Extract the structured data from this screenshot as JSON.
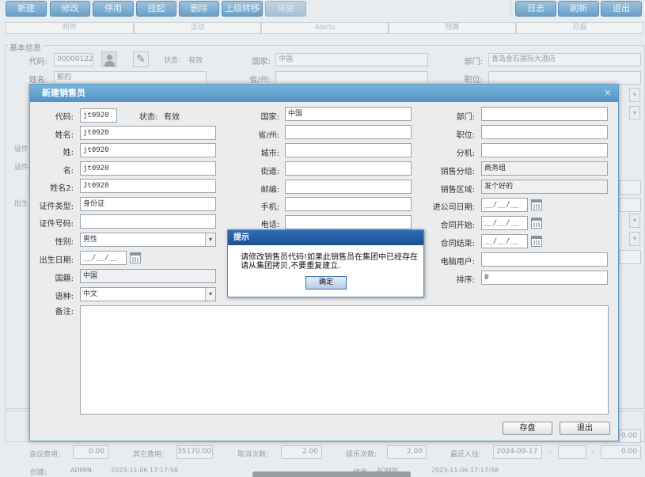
{
  "toolbar": {
    "new": "新建",
    "edit": "修改",
    "disable": "停用",
    "suspend": "挂起",
    "delete": "删除",
    "move_superior": "上级转移",
    "restore": "恢复",
    "log": "日志",
    "refresh": "刷新",
    "exit": "退出"
  },
  "panel_tabs": [
    "附件",
    "活动",
    "Alerts",
    "预算",
    "月报"
  ],
  "base_section": {
    "legend": "基本信息",
    "code_label": "代码:",
    "code_value": "00000122",
    "status_label": "状态:",
    "status_value": "有效",
    "country_label": "国家:",
    "country_value": "中国",
    "dept_label": "部门:",
    "dept_value": "青岛金石国际大酒店",
    "name_label": "姓名:",
    "name_value": "鄞的",
    "province_label": "省/州:",
    "position_label": "职位:",
    "side_labels": [
      "证件",
      "证件",
      "出生"
    ]
  },
  "bottom_bar": {
    "meeting_fee_label": "会议费用:",
    "meeting_fee": "0.00",
    "other_fee_label": "其它费用:",
    "other_fee": "35170.00",
    "cancel_count_label": "取消次数:",
    "cancel_count": "2.00",
    "ent_count_label": "娱乐次数:",
    "ent_count": "2.00",
    "recent_checkin_label": "最近入住:",
    "recent_checkin": "2024-09-17",
    "dash": "-",
    "right_value_1": "0.00",
    "right_value_2": "0.00",
    "created_label": "创建:",
    "created_user": "ADMIN",
    "created_time": "2023-11-06 17:17:58",
    "modified_label": "修改:",
    "modified_user": "ADMIN",
    "modified_time": "2023-11-06 17:17:58"
  },
  "dialog": {
    "title": "新建销售员",
    "close": "×",
    "code_label": "代码:",
    "code_value": "jt0920",
    "status_label": "状态:",
    "status_value": "有效",
    "name_label": "姓名:",
    "name_value": "jt0920",
    "surname_label": "姓:",
    "surname_value": "jt0920",
    "given_label": "名:",
    "given_value": "jt0920",
    "name2_label": "姓名2:",
    "name2_value": "Jt0920",
    "idtype_label": "证件类型:",
    "idtype_value": "身份证",
    "idno_label": "证件号码:",
    "gender_label": "性别:",
    "gender_value": "男性",
    "birth_label": "出生日期:",
    "birth_value": "__/__/__",
    "nation_label": "国籍:",
    "nation_value": "中国",
    "lang_label": "语种:",
    "lang_value": "中文",
    "remark_label": "备注:",
    "country_label": "国家:",
    "country_value": "中国",
    "province_label": "省/州:",
    "city_label": "城市:",
    "street_label": "街道:",
    "zip_label": "邮编:",
    "mobile_label": "手机:",
    "phone_label": "电话:",
    "dept_label": "部门:",
    "position_label": "职位:",
    "ext_label": "分机:",
    "salesgroup_label": "销售分组:",
    "salesgroup_value": "商务组",
    "salesarea_label": "销售区域:",
    "salesarea_value": "发个好的",
    "joindate_label": "进公司日期:",
    "joindate_value": "__/__/__",
    "contractstart_label": "合同开始:",
    "contractstart_value": "__/__/__",
    "contractend_label": "合同结束:",
    "contractend_value": "__/__/__",
    "pcuser_label": "电脑用户:",
    "sort_label": "排序:",
    "sort_value": "0",
    "save_button": "存盘",
    "exit_button": "退出"
  },
  "alert": {
    "title": "提示",
    "message": "请修改销售员代码!如果此销售员在集团中已经存在请从集团拷贝,不要重复建立.",
    "ok_button": "确定"
  }
}
